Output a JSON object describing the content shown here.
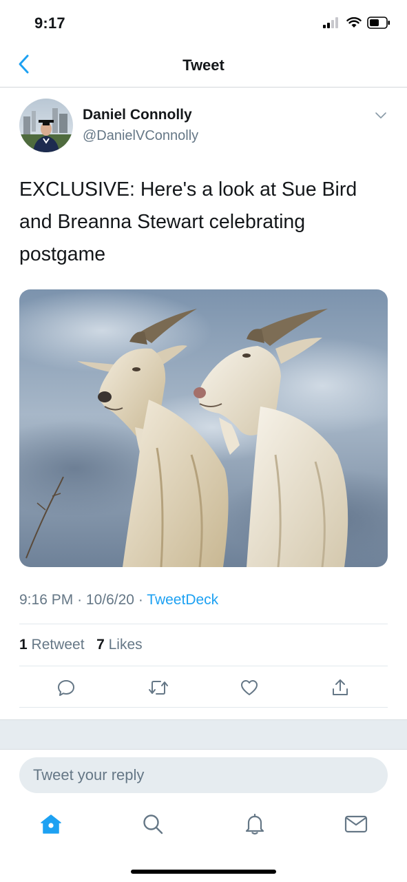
{
  "status_bar": {
    "time": "9:17",
    "icons": [
      "signal-icon",
      "wifi-icon",
      "battery-icon"
    ]
  },
  "nav": {
    "title": "Tweet",
    "back_icon": "chevron-left-icon"
  },
  "tweet": {
    "author_name": "Daniel Connolly",
    "author_handle": "@DanielVConnolly",
    "text": "EXCLUSIVE: Here's a look at Sue Bird and Breanna Stewart celebrating postgame",
    "media": "photo of two white goats against a cloudy sky",
    "time": "9:16 PM",
    "date": "10/6/20",
    "separator": "·",
    "source": "TweetDeck",
    "retweet_count": "1",
    "retweet_label": "Retweet",
    "like_count": "7",
    "like_label": "Likes"
  },
  "actions": [
    "reply-icon",
    "retweet-icon",
    "like-icon",
    "share-icon"
  ],
  "reply": {
    "placeholder": "Tweet your reply"
  },
  "tab_bar": {
    "items": [
      "home-icon",
      "search-icon",
      "notifications-icon",
      "messages-icon"
    ],
    "active": "home-icon"
  },
  "colors": {
    "accent": "#1da1f2",
    "secondary_text": "#657786",
    "primary_text": "#14171a",
    "band": "#e6ecf0"
  }
}
